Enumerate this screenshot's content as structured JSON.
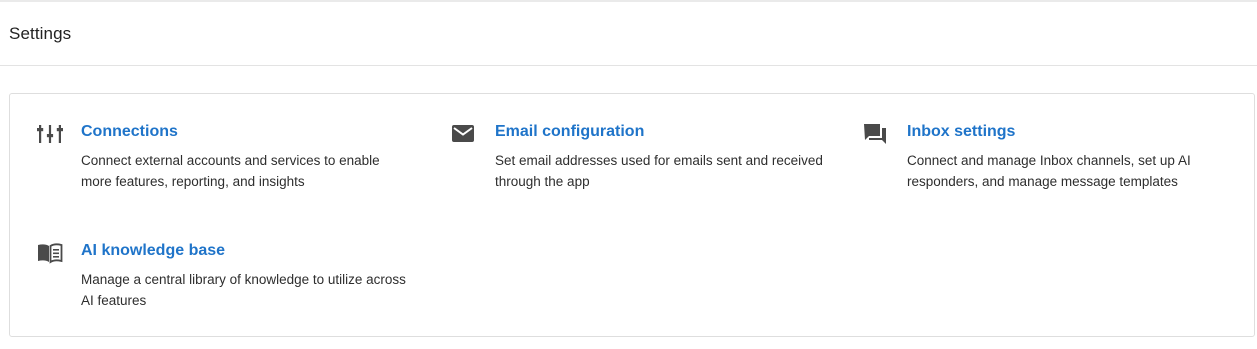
{
  "header": {
    "title": "Settings"
  },
  "cards": [
    {
      "title": "Connections",
      "description": "Connect external accounts and services to enable more features, reporting, and insights",
      "icon": "sliders-icon"
    },
    {
      "title": "Email configuration",
      "description": "Set email addresses used for emails sent and received through the app",
      "icon": "envelope-icon"
    },
    {
      "title": "Inbox settings",
      "description": "Connect and manage Inbox channels, set up AI responders, and manage message templates",
      "icon": "chat-bubble-icon"
    },
    {
      "title": "AI knowledge base",
      "description": "Manage a central library of knowledge to utilize across AI features",
      "icon": "book-icon"
    }
  ],
  "colors": {
    "link": "#1f74c9",
    "icon": "#4a4a4a",
    "text": "#2e2e2e",
    "border": "#dedede"
  }
}
